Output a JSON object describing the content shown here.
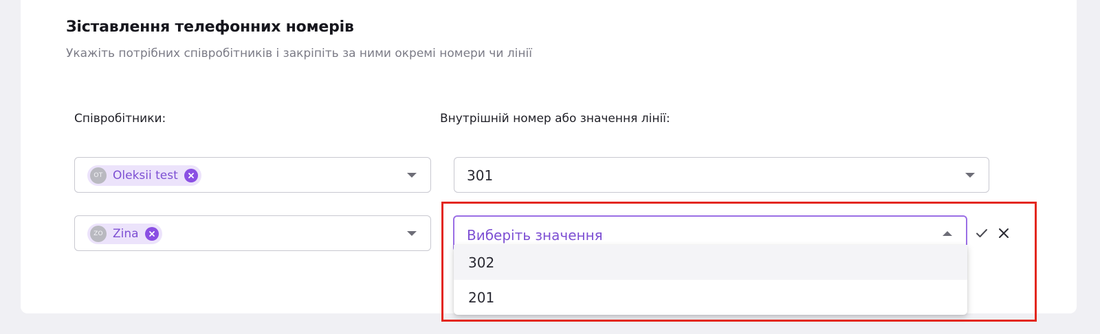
{
  "section": {
    "title": "Зіставлення телефонних номерів",
    "subtitle": "Укажіть потрібних співробітників і закріпіть за ними окремі номери чи лінії"
  },
  "columns": {
    "employees_label": "Співробітники:",
    "number_label": "Внутрішній номер або значення лінії:"
  },
  "rows": [
    {
      "employee": {
        "initials": "OT",
        "name": "Oleksii test"
      },
      "number_value": "301"
    },
    {
      "employee": {
        "initials": "ZO",
        "name": "Zina"
      },
      "number_placeholder": "Виберіть значення"
    }
  ],
  "dropdown": {
    "options": [
      "302",
      "201"
    ]
  },
  "icons": {
    "confirm": "check-icon",
    "cancel": "close-icon",
    "remove_chip": "remove-circle-icon",
    "caret": "caret-icon"
  },
  "colors": {
    "accent": "#8a4fe3",
    "chip_bg": "#ece3fb",
    "highlight": "#e3271c"
  }
}
